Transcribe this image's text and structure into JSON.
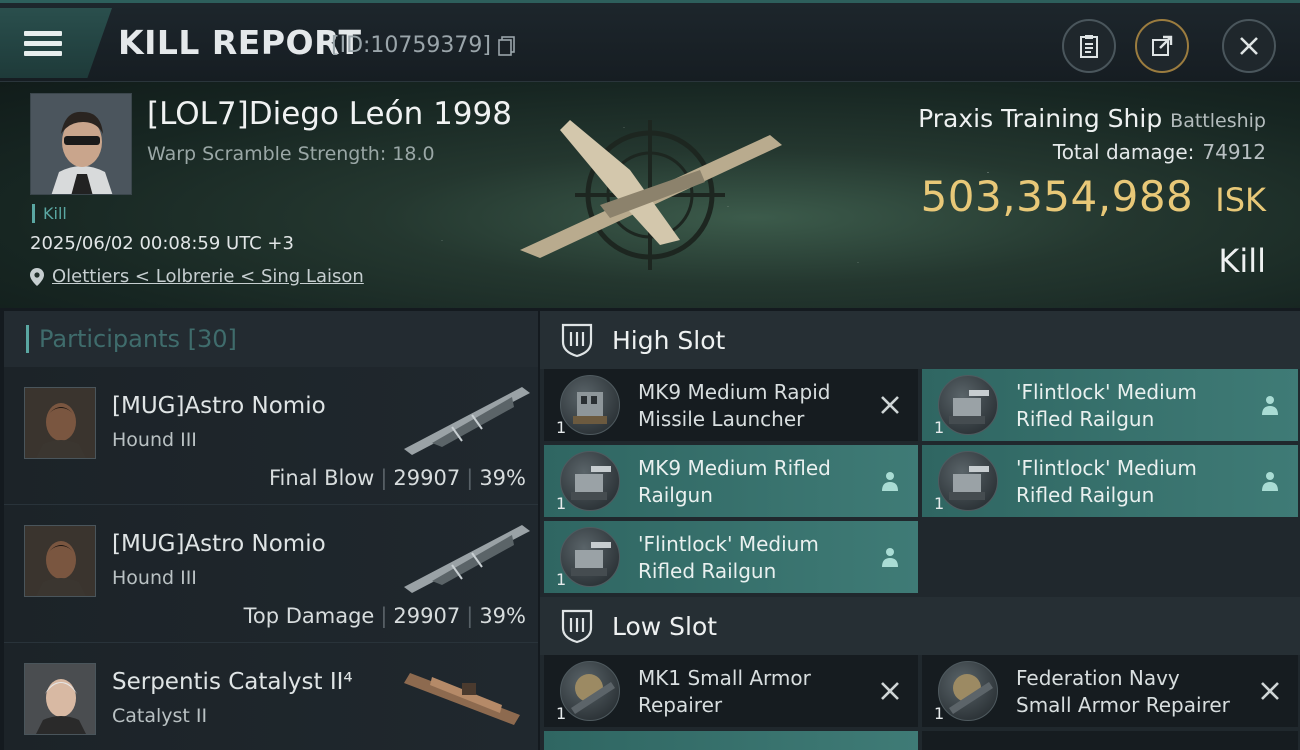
{
  "header": {
    "title": "KILL REPORT",
    "kill_id": "[ID:10759379]"
  },
  "victim": {
    "name": "[LOL7]Diego León 1998",
    "warp_scramble": "Warp Scramble Strength: 18.0",
    "tag": "Kill",
    "datetime": "2025/06/02 00:08:59 UTC +3",
    "location": "Olettiers < Lolbrerie < Sing Laison",
    "ship_name": "Praxis Training Ship",
    "ship_class": "Battleship",
    "total_damage_label": "Total damage:",
    "total_damage": "74912",
    "isk_value": "503,354,988",
    "isk_unit": "ISK",
    "result": "Kill"
  },
  "participants": {
    "label": "Participants [30]",
    "rows": [
      {
        "name": "[MUG]Astro Nomio",
        "ship": "Hound III",
        "role": "Final Blow",
        "damage": "29907",
        "pct": "39%"
      },
      {
        "name": "[MUG]Astro Nomio",
        "ship": "Hound III",
        "role": "Top Damage",
        "damage": "29907",
        "pct": "39%"
      },
      {
        "name": "Serpentis Catalyst II⁴",
        "ship": "Catalyst II",
        "role": "",
        "damage": "",
        "pct": ""
      }
    ]
  },
  "slots": {
    "high": {
      "label": "High Slot",
      "modules": [
        {
          "name": "MK9 Medium Rapid Missile Launcher",
          "qty": "1",
          "status": "destroyed"
        },
        {
          "name": "'Flintlock' Medium Rifled Railgun",
          "qty": "1",
          "status": "dropped"
        },
        {
          "name": "MK9 Medium Rifled Railgun",
          "qty": "1",
          "status": "dropped"
        },
        {
          "name": "'Flintlock' Medium Rifled Railgun",
          "qty": "1",
          "status": "dropped"
        },
        {
          "name": "'Flintlock' Medium Rifled Railgun",
          "qty": "1",
          "status": "dropped"
        }
      ]
    },
    "low": {
      "label": "Low Slot",
      "modules": [
        {
          "name": "MK1 Small Armor Repairer",
          "qty": "1",
          "status": "destroyed"
        },
        {
          "name": "Federation Navy Small Armor Repairer",
          "qty": "1",
          "status": "destroyed"
        }
      ]
    }
  },
  "colors": {
    "accent": "#5aa7a2",
    "isk": "#e8c878",
    "fitted": "#3f7b76"
  }
}
